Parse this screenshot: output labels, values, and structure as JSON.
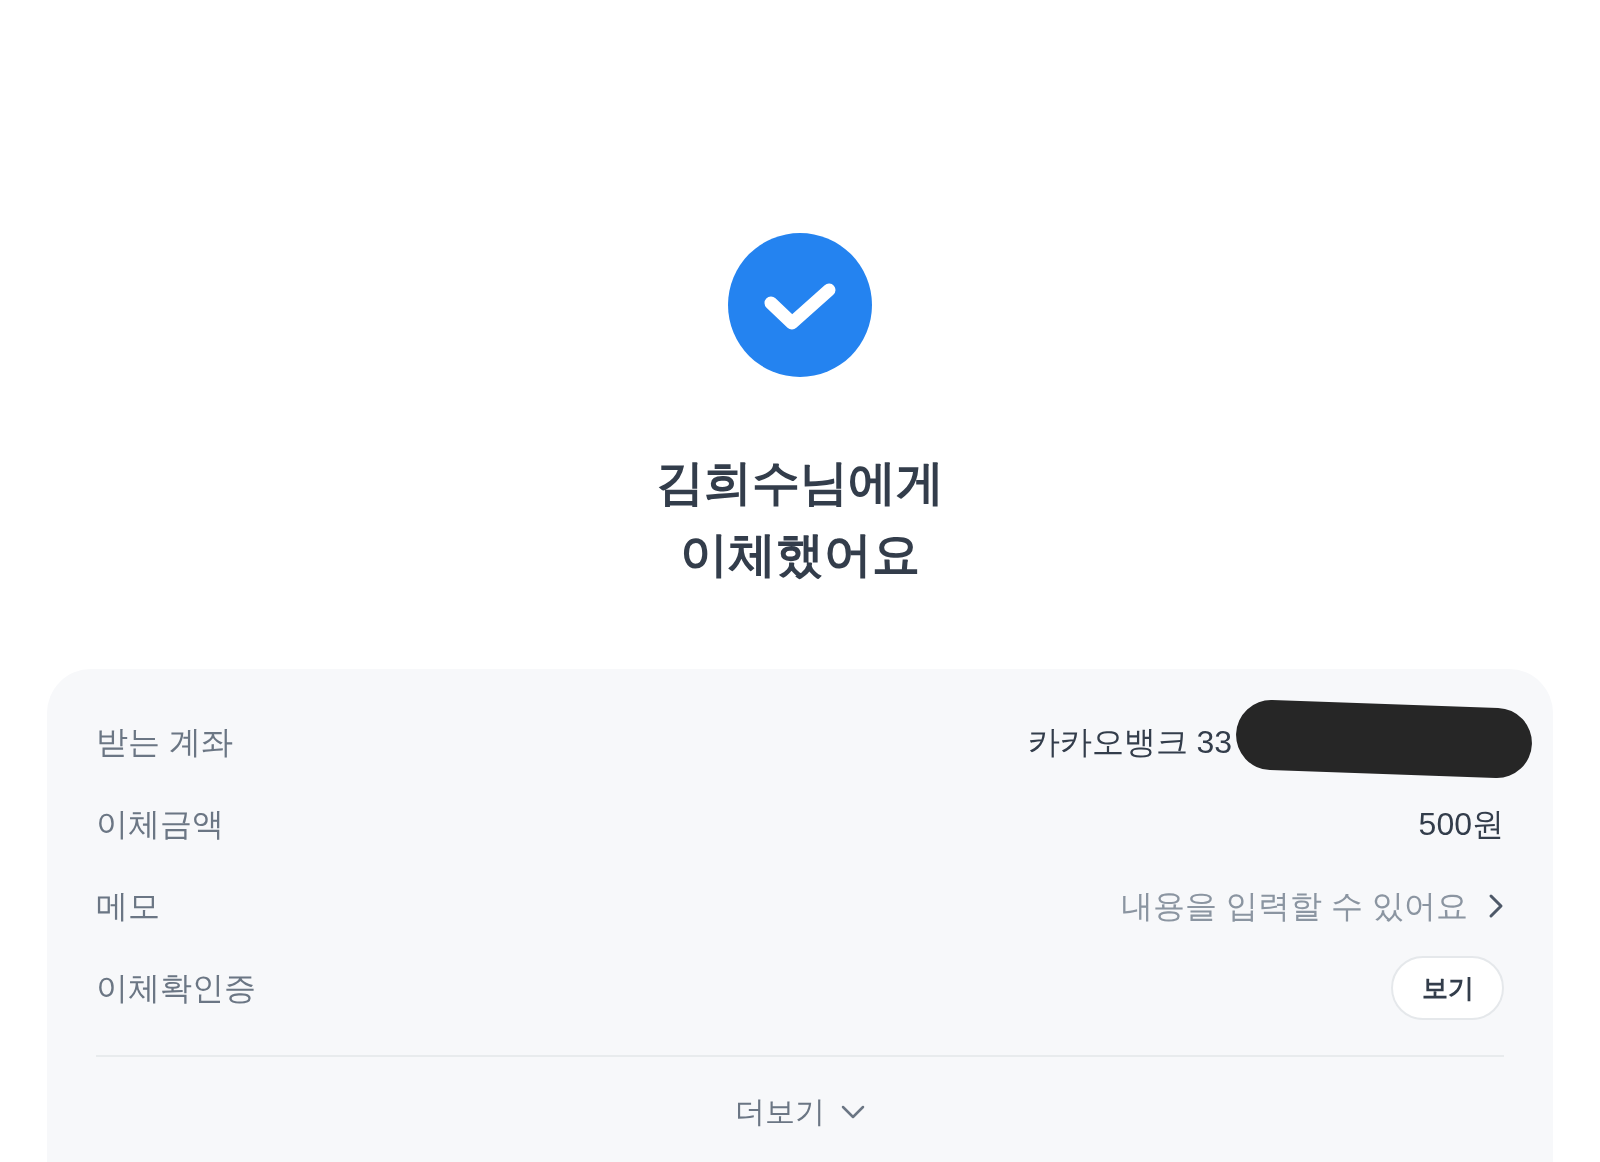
{
  "status": {
    "title_lines": [
      "김희수님에게",
      "이체했어요"
    ]
  },
  "details": [
    {
      "kind": "text",
      "label": "받는 계좌",
      "value": "카카오뱅크 33",
      "redacted": true
    },
    {
      "kind": "text",
      "label": "이체금액",
      "value": "500원"
    },
    {
      "kind": "link",
      "label": "메모",
      "placeholder": "내용을 입력할 수 있어요"
    },
    {
      "kind": "button",
      "label": "이체확인증",
      "button": "보기"
    }
  ],
  "more": {
    "label": "더보기",
    "expanded": false
  }
}
